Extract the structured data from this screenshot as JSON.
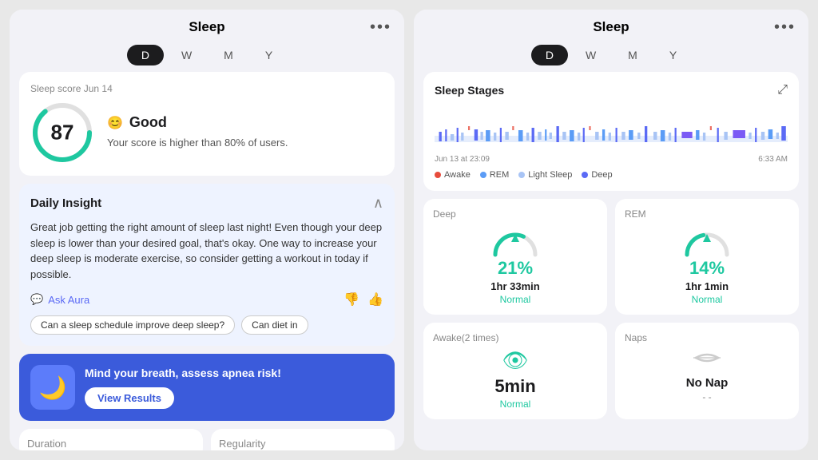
{
  "left_panel": {
    "title": "Sleep",
    "tabs": [
      "D",
      "W",
      "M",
      "Y"
    ],
    "active_tab": "D",
    "sleep_score": {
      "label": "Sleep score",
      "date": "Jun 14",
      "score": "87",
      "emoji": "😊",
      "rating": "Good",
      "description": "Your score is higher than 80% of users."
    },
    "daily_insight": {
      "title": "Daily Insight",
      "text": "Great job getting the right amount of sleep last night! Even though your deep sleep is lower than your desired goal, that's okay. One way to increase your deep sleep is moderate exercise, so consider getting a workout in today if possible.",
      "ask_aura_label": "Ask Aura",
      "suggestions": [
        "Can a sleep schedule improve deep sleep?",
        "Can diet in"
      ]
    },
    "promo": {
      "icon": "🌙",
      "text": "Mind your breath, assess apnea risk!",
      "button_label": "View Results"
    },
    "bottom_labels": [
      "Duration",
      "Regularity"
    ]
  },
  "right_panel": {
    "title": "Sleep",
    "tabs": [
      "D",
      "W",
      "M",
      "Y"
    ],
    "active_tab": "D",
    "sleep_stages": {
      "title": "Sleep Stages",
      "time_start": "Jun 13 at 23:09",
      "time_end": "6:33 AM",
      "legend": [
        {
          "label": "Awake",
          "color": "#e74c3c"
        },
        {
          "label": "REM",
          "color": "#5b9cf6"
        },
        {
          "label": "Light Sleep",
          "color": "#a8c4f5"
        },
        {
          "label": "Deep",
          "color": "#5b6af5"
        }
      ]
    },
    "deep": {
      "label": "Deep",
      "percent": "21%",
      "time": "1hr 33min",
      "status": "Normal",
      "color": "#1ec8a0"
    },
    "rem": {
      "label": "REM",
      "percent": "14%",
      "time": "1hr 1min",
      "status": "Normal",
      "color": "#1ec8a0"
    },
    "awake": {
      "label": "Awake(2 times)",
      "time": "5min",
      "status": "Normal",
      "color": "#1ec8a0"
    },
    "naps": {
      "label": "Naps",
      "text": "No Nap",
      "dash": "- -"
    }
  },
  "icons": {
    "more": "•••",
    "expand": "⤢",
    "chevron_up": "^",
    "thumbs_down": "👎",
    "thumbs_up": "👍",
    "aura_icon": "💬",
    "eye_icon": "👁"
  }
}
